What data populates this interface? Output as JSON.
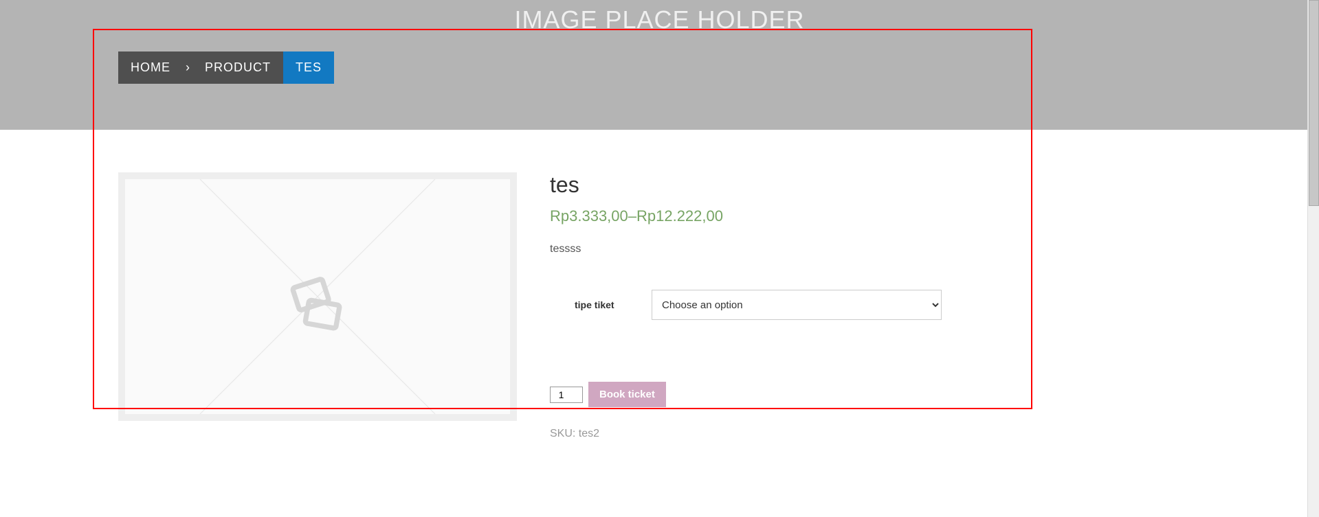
{
  "hero": {
    "title": "IMAGE PLACE HOLDER"
  },
  "breadcrumb": {
    "items": [
      "HOME",
      "PRODUCT"
    ],
    "current": "TES",
    "separator": "›"
  },
  "product": {
    "title": "tes",
    "price": "Rp3.333,00–Rp12.222,00",
    "desc": "tessss",
    "option_label": "tipe tiket",
    "select_placeholder": "Choose an option",
    "qty": "1",
    "book_label": "Book ticket",
    "sku_line": "SKU: tes2"
  }
}
